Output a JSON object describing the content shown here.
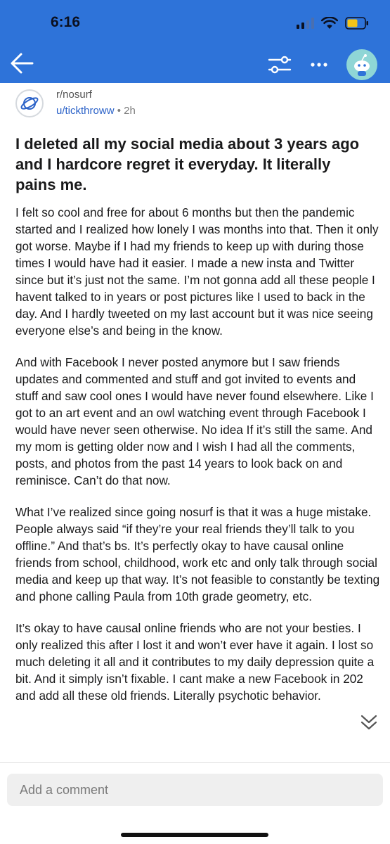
{
  "status_bar": {
    "time": "6:16",
    "icons": [
      "cellular-signal-icon",
      "wifi-icon",
      "battery-icon"
    ],
    "battery_color": "#f5c518"
  },
  "toolbar": {
    "icons": [
      "back-arrow-icon",
      "filter-sort-icon",
      "more-options-icon",
      "user-avatar-icon"
    ],
    "accent_color": "#2e73d9"
  },
  "post": {
    "subreddit": "r/nosurf",
    "username": "u/tickthroww",
    "separator": " • ",
    "age": "2h",
    "title": "I deleted all my social media about 3 years ago and I hardcore regret it everyday. It literally pains me.",
    "paragraphs": [
      "I felt so cool and free for about 6 months but then the pandemic started and I realized how lonely I was months into that. Then it only got worse. Maybe if I had my friends to keep up with during those times I would have had it easier. I made a new insta and Twitter since but it’s just not the same. I’m not gonna add all these people I havent talked to in years or post pictures like I used to back in the day. And I hardly tweeted on my last account but it was nice seeing everyone else’s and being in the know.",
      "And with Facebook I never posted anymore but I saw friends updates and commented and stuff and got invited to events and stuff and saw cool ones I would have never found elsewhere. Like I got to an art event and an owl watching event through Facebook I would have never seen otherwise. No idea If it’s still the same. And my mom is getting older now and I wish I had all the comments, posts, and photos from the past 14 years to look back on and reminisce. Can’t do that now.",
      "What I’ve realized since going nosurf is that it was a huge mistake. People always said “if they’re your real friends they’ll talk to you offline.” And that’s bs. It’s perfectly okay to have causal online friends from school, childhood, work etc and only talk through social media and keep up that way. It’s not feasible to constantly be texting and phone calling Paula from 10th grade geometry, etc.",
      "It’s okay to have causal online friends who are not your besties. I only realized this after I lost it and won’t ever have it again. I lost so much deleting it all and it contributes to my daily depression quite a bit. And it simply isn’t fixable. I cant make a new Facebook in 202 and add all these old friends. Literally psychotic behavior."
    ]
  },
  "comment_box": {
    "placeholder": "Add a comment"
  }
}
